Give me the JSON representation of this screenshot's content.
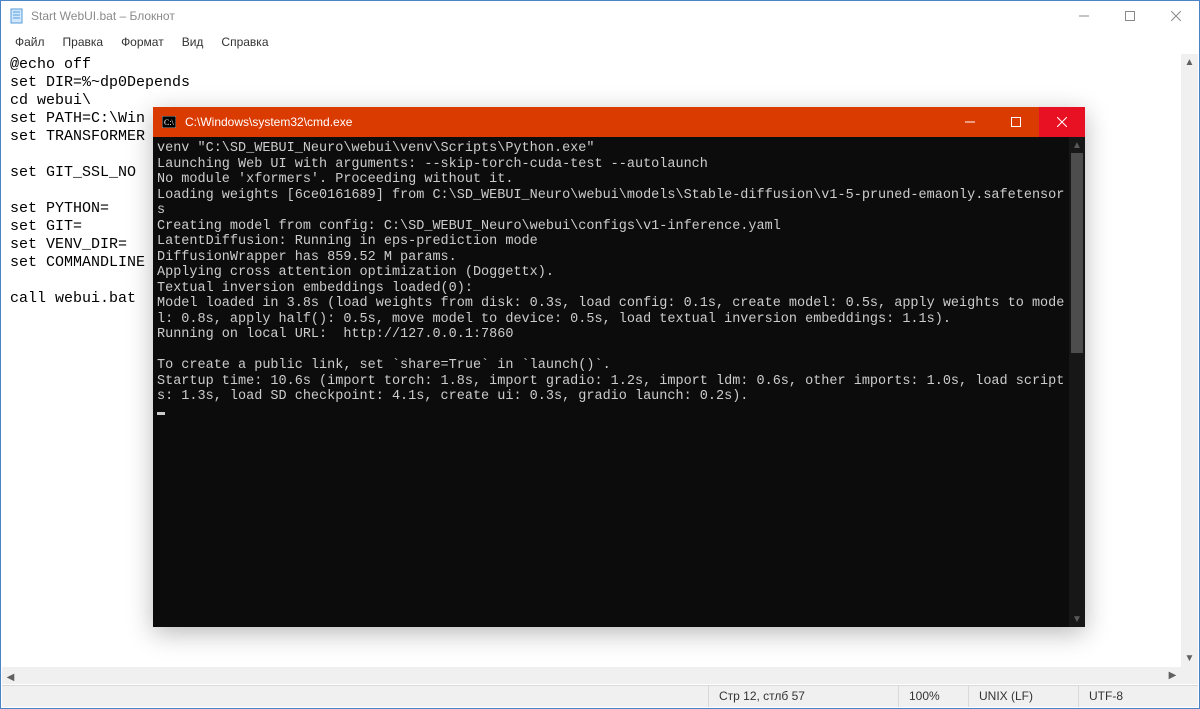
{
  "notepad": {
    "title": "Start WebUI.bat – Блокнот",
    "menu": {
      "file": "Файл",
      "edit": "Правка",
      "format": "Формат",
      "view": "Вид",
      "help": "Справка"
    },
    "content": "@echo off\nset DIR=%~dp0Depends\ncd webui\\\nset PATH=C:\\Win\nset TRANSFORMER\n\nset GIT_SSL_NO\n\nset PYTHON=\nset GIT=\nset VENV_DIR=\nset COMMANDLINE\n\ncall webui.bat",
    "status": {
      "pos": "Стр 12, стлб 57",
      "zoom": "100%",
      "eol": "UNIX (LF)",
      "encoding": "UTF-8"
    }
  },
  "cmd": {
    "title": "C:\\Windows\\system32\\cmd.exe",
    "output": "venv \"C:\\SD_WEBUI_Neuro\\webui\\venv\\Scripts\\Python.exe\"\nLaunching Web UI with arguments: --skip-torch-cuda-test --autolaunch\nNo module 'xformers'. Proceeding without it.\nLoading weights [6ce0161689] from C:\\SD_WEBUI_Neuro\\webui\\models\\Stable-diffusion\\v1-5-pruned-emaonly.safetensors\nCreating model from config: C:\\SD_WEBUI_Neuro\\webui\\configs\\v1-inference.yaml\nLatentDiffusion: Running in eps-prediction mode\nDiffusionWrapper has 859.52 M params.\nApplying cross attention optimization (Doggettx).\nTextual inversion embeddings loaded(0):\nModel loaded in 3.8s (load weights from disk: 0.3s, load config: 0.1s, create model: 0.5s, apply weights to model: 0.8s, apply half(): 0.5s, move model to device: 0.5s, load textual inversion embeddings: 1.1s).\nRunning on local URL:  http://127.0.0.1:7860\n\nTo create a public link, set `share=True` in `launch()`.\nStartup time: 10.6s (import torch: 1.8s, import gradio: 1.2s, import ldm: 0.6s, other imports: 1.0s, load scripts: 1.3s, load SD checkpoint: 4.1s, create ui: 0.3s, gradio launch: 0.2s)."
  }
}
